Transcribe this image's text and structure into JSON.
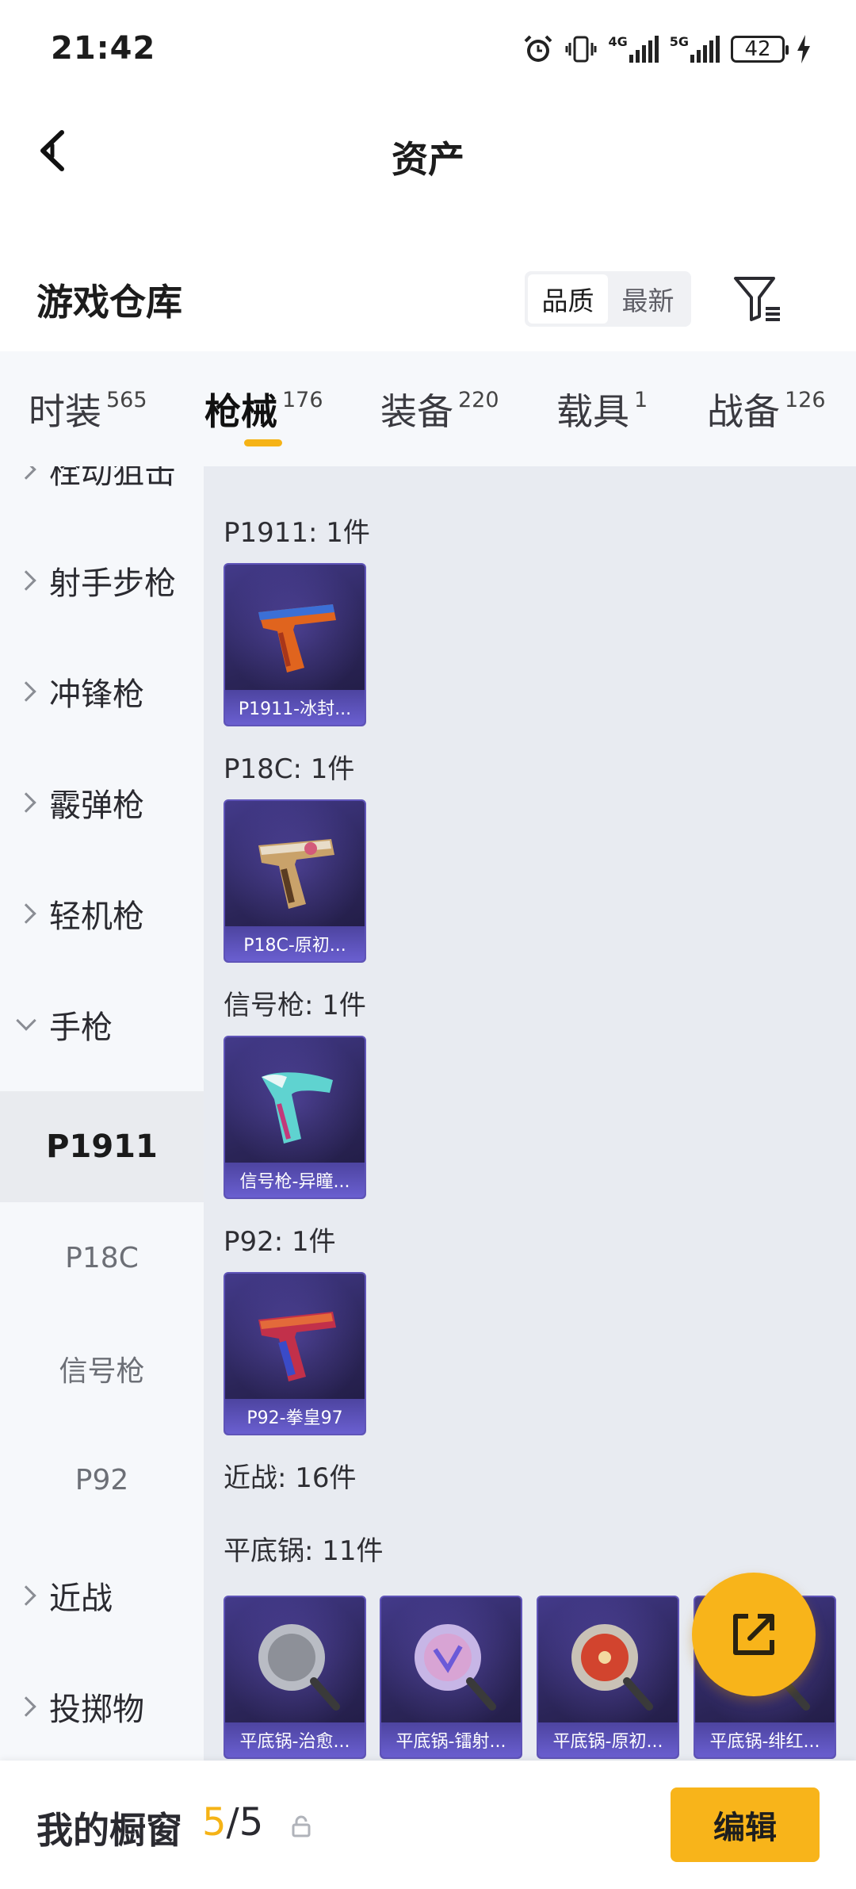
{
  "status_bar": {
    "time": "21:42",
    "signal1_label": "4G",
    "signal2_label": "5G",
    "battery": "42",
    "icons": [
      "alarm-icon",
      "vibrate-icon",
      "signal-4g-icon",
      "signal-5g-icon",
      "battery-icon",
      "charging-icon"
    ]
  },
  "header": {
    "title": "资产"
  },
  "section": {
    "title": "游戏仓库",
    "sort_options": [
      "品质",
      "最新"
    ],
    "sort_selected": "品质"
  },
  "tabs": [
    {
      "label": "时装",
      "count": "565"
    },
    {
      "label": "枪械",
      "count": "176",
      "active": true
    },
    {
      "label": "装备",
      "count": "220"
    },
    {
      "label": "载具",
      "count": "1"
    },
    {
      "label": "战备",
      "count": "126"
    }
  ],
  "sidebar": {
    "categories": [
      {
        "label": "栓动狙击"
      },
      {
        "label": "射手步枪"
      },
      {
        "label": "冲锋枪"
      },
      {
        "label": "霰弹枪"
      },
      {
        "label": "轻机枪"
      },
      {
        "label": "手枪",
        "expanded": true
      },
      {
        "label": "近战"
      },
      {
        "label": "投掷物"
      }
    ],
    "subitems": [
      {
        "label": "P1911",
        "active": true
      },
      {
        "label": "P18C"
      },
      {
        "label": "信号枪"
      },
      {
        "label": "P92"
      }
    ]
  },
  "content": {
    "groups": [
      {
        "label": "P1911: 1件",
        "items": [
          {
            "name": "P1911-冰封...",
            "art": "pistol-orange"
          }
        ]
      },
      {
        "label": "P18C: 1件",
        "items": [
          {
            "name": "P18C-原初...",
            "art": "pistol-gold"
          }
        ]
      },
      {
        "label": "信号枪: 1件",
        "items": [
          {
            "name": "信号枪-异瞳...",
            "art": "flare-gun"
          }
        ]
      },
      {
        "label": "P92: 1件",
        "items": [
          {
            "name": "P92-拳皇97",
            "art": "pistol-red"
          }
        ]
      }
    ],
    "melee_label": "近战: 16件",
    "pan_group": {
      "label": "平底锅: 11件",
      "items": [
        {
          "name": "平底锅-治愈...",
          "art": "pan-silver"
        },
        {
          "name": "平底锅-镭射...",
          "art": "pan-holo"
        },
        {
          "name": "平底锅-原初...",
          "art": "pan-red"
        },
        {
          "name": "平底锅-绯红...",
          "art": "pan-crimson"
        }
      ]
    }
  },
  "fab": {
    "icon": "share-icon"
  },
  "bottom_bar": {
    "title": "我的橱窗",
    "count_current": "5",
    "count_total": "/5",
    "edit_label": "编辑"
  },
  "colors": {
    "accent": "#f8b41a",
    "item_card": "#2b2558",
    "item_caption": "#6a5fd0",
    "sidebar_bg": "#f6f8fb",
    "content_bg": "#e8ebf1"
  }
}
